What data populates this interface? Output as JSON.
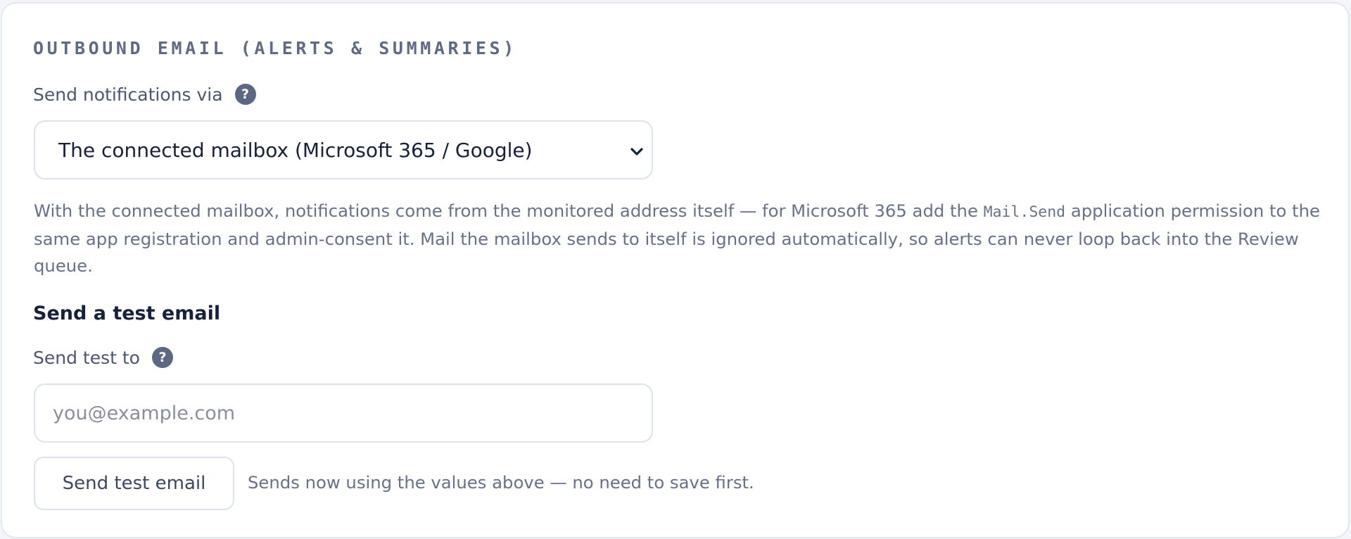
{
  "section": {
    "title": "OUTBOUND EMAIL (ALERTS & SUMMARIES)"
  },
  "notify": {
    "label": "Send notifications via",
    "help_icon": "?",
    "selected": "The connected mailbox (Microsoft 365 / Google)",
    "chevron_icon": "chevron-down-icon",
    "help_text_before": "With the connected mailbox, notifications come from the monitored address itself — for Microsoft 365 add the ",
    "help_text_code": "Mail.Send",
    "help_text_after": " application permission to the same app registration and admin-consent it. Mail the mailbox sends to itself is ignored automatically, so alerts can never loop back into the Review queue."
  },
  "test": {
    "heading": "Send a test email",
    "label": "Send test to",
    "help_icon": "?",
    "placeholder": "you@example.com",
    "value": "",
    "button_label": "Send test email",
    "hint": "Sends now using the values above — no need to save first."
  },
  "colors": {
    "card_background": "#ffffff",
    "card_border": "#e3e8f0",
    "help_icon_bg": "#5c6784",
    "heading_text": "#16213b",
    "muted_text": "#66718a"
  }
}
